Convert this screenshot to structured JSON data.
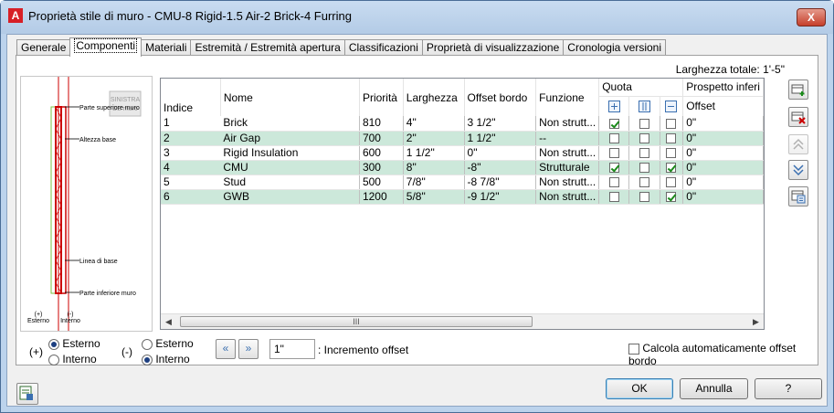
{
  "window": {
    "title": "Proprietà stile di muro - CMU-8 Rigid-1.5 Air-2 Brick-4 Furring",
    "app_icon": "A",
    "close_label": "X"
  },
  "tabs": [
    {
      "label": "Generale"
    },
    {
      "label": "Componenti",
      "active": true
    },
    {
      "label": "Materiali"
    },
    {
      "label": "Estremità / Estremità apertura"
    },
    {
      "label": "Classificazioni"
    },
    {
      "label": "Proprietà di visualizzazione"
    },
    {
      "label": "Cronologia versioni"
    }
  ],
  "total_width": "Larghezza totale: 1'-5\"",
  "preview": {
    "badge": "SINISTRA",
    "badge2": "DE muro",
    "label_top": "Parte superiore muro",
    "label_base_height": "Altezza base",
    "label_baseline": "Linea di base",
    "label_bottom": "Parte inferiore muro",
    "ext_sign": "(+)",
    "ext_label": "Esterno",
    "int_sign": "(-)",
    "int_label": "Interno"
  },
  "grid": {
    "headers": {
      "index": "Indice",
      "name": "Nome",
      "priority": "Priorità",
      "width": "Larghezza",
      "edge_offset": "Offset bordo",
      "function": "Funzione",
      "dimension": "Quota",
      "bottom_elevation": "Prospetto inferi",
      "offset": "Offset"
    },
    "rows": [
      {
        "index": "1",
        "name": "Brick",
        "priority": "810",
        "width": "4\"",
        "edge_offset": "3 1/2\"",
        "function": "Non strutt...",
        "q1": true,
        "q2": false,
        "q3": false,
        "offset": "0\""
      },
      {
        "index": "2",
        "name": "Air Gap",
        "priority": "700",
        "width": "2\"",
        "edge_offset": "1 1/2\"",
        "function": "--",
        "q1": false,
        "q2": false,
        "q3": false,
        "offset": "0\""
      },
      {
        "index": "3",
        "name": "Rigid Insulation",
        "priority": "600",
        "width": "1 1/2\"",
        "edge_offset": "0\"",
        "function": "Non strutt...",
        "q1": false,
        "q2": false,
        "q3": false,
        "offset": "0\""
      },
      {
        "index": "4",
        "name": "CMU",
        "priority": "300",
        "width": "8\"",
        "edge_offset": "-8\"",
        "function": "Strutturale",
        "q1": true,
        "q2": false,
        "q3": true,
        "offset": "0\""
      },
      {
        "index": "5",
        "name": "Stud",
        "priority": "500",
        "width": "7/8\"",
        "edge_offset": "-8 7/8\"",
        "function": "Non strutt...",
        "q1": false,
        "q2": false,
        "q3": false,
        "offset": "0\""
      },
      {
        "index": "6",
        "name": "GWB",
        "priority": "1200",
        "width": "5/8\"",
        "edge_offset": "-9 1/2\"",
        "function": "Non strutt...",
        "q1": false,
        "q2": false,
        "q3": true,
        "offset": "0\""
      }
    ],
    "scroll_thumb": "III"
  },
  "bottom": {
    "plus_sign": "(+)",
    "minus_sign": "(-)",
    "left_opt1": "Esterno",
    "left_opt2": "Interno",
    "right_opt1": "Esterno",
    "right_opt2": "Interno",
    "offset_value": "1\"",
    "offset_label": ": Incremento offset",
    "auto_offset_label": "Calcola automaticamente offset bordo"
  },
  "buttons": {
    "ok": "OK",
    "cancel": "Annulla",
    "help": "?"
  }
}
